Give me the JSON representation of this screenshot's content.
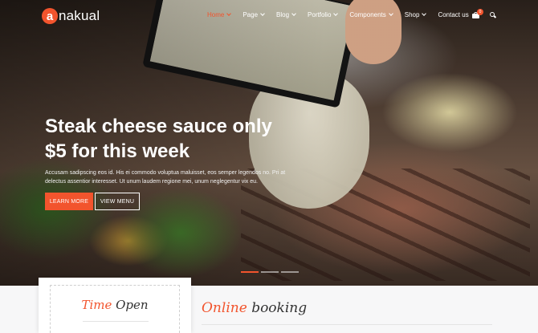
{
  "brand": {
    "logo_letter": "a",
    "name": "nakual",
    "accent": "#f2542d"
  },
  "nav": {
    "items": [
      {
        "label": "Home",
        "active": true,
        "dropdown": true
      },
      {
        "label": "Page",
        "active": false,
        "dropdown": true
      },
      {
        "label": "Blog",
        "active": false,
        "dropdown": true
      },
      {
        "label": "Portfolio",
        "active": false,
        "dropdown": true
      },
      {
        "label": "Components",
        "active": false,
        "dropdown": true
      },
      {
        "label": "Shop",
        "active": false,
        "dropdown": true
      },
      {
        "label": "Contact us",
        "active": false,
        "dropdown": false
      }
    ],
    "cart_count": "0",
    "icons": [
      "cart-icon",
      "search-icon"
    ]
  },
  "hero": {
    "headline_line1": "Steak cheese sauce only",
    "headline_line2": "$5 for this week",
    "description": "Accusam sadipscing eos id. His ei commodo voluptua maluisset, eos semper legendos no. Pri at delectus assentior interesset. Ut unum laudem regione mei, unum neglegentur vix eu.",
    "button_primary": "LEARN MORE",
    "button_secondary": "VIEW MENU",
    "slides": 3,
    "active_slide": 1
  },
  "time_open": {
    "word1": "Time",
    "word2": "Open"
  },
  "online_booking": {
    "word1": "Online",
    "word2": "booking"
  }
}
